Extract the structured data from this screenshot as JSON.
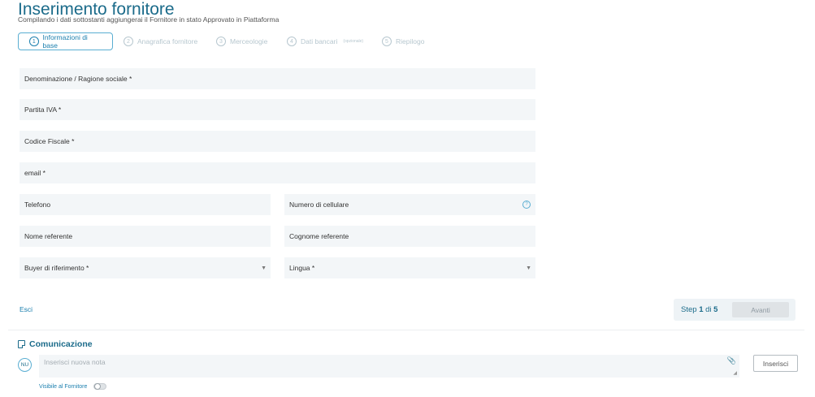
{
  "header": {
    "title": "Inserimento fornitore",
    "subtitle": "Compilando i dati sottostanti aggiungerai il Fornitore in stato Approvato in Piattaforma"
  },
  "steps": [
    {
      "num": "1",
      "label": "Informazioni di base",
      "active": true
    },
    {
      "num": "2",
      "label": "Anagrafica fornitore",
      "active": false
    },
    {
      "num": "3",
      "label": "Merceologie",
      "active": false
    },
    {
      "num": "4",
      "label": "Dati bancari",
      "note": "(opzionale)",
      "active": false
    },
    {
      "num": "5",
      "label": "Riepilogo",
      "active": false
    }
  ],
  "form": {
    "denominazione": "Denominazione / Ragione sociale *",
    "partita_iva": "Partita IVA *",
    "codice_fiscale": "Codice Fiscale *",
    "email": "email *",
    "telefono": "Telefono",
    "cellulare": "Numero di cellulare",
    "nome_referente": "Nome referente",
    "cognome_referente": "Cognome referente",
    "buyer": "Buyer di riferimento *",
    "lingua": "Lingua *"
  },
  "footer": {
    "esci": "Esci",
    "step_prefix": "Step",
    "step_current": "1",
    "step_of": "di",
    "step_total": "5",
    "avanti": "Avanti"
  },
  "comunicazione": {
    "title": "Comunicazione",
    "avatar": "NU",
    "placeholder": "Inserisci nuova nota",
    "inserisci": "Inserisci",
    "visibile": "Visibile al Fornitore",
    "visibile_on": false
  },
  "icons": {
    "step_numbers": "circled-number-icon",
    "dropdown": "chevron-down-icon",
    "help": "question-circle-icon",
    "note": "note-icon",
    "attach": "paperclip-icon",
    "resize": "resize-handle-icon"
  },
  "colors": {
    "accent": "#1b7fae",
    "title": "#1b6b8a",
    "field_bg": "#f3f6f8"
  }
}
